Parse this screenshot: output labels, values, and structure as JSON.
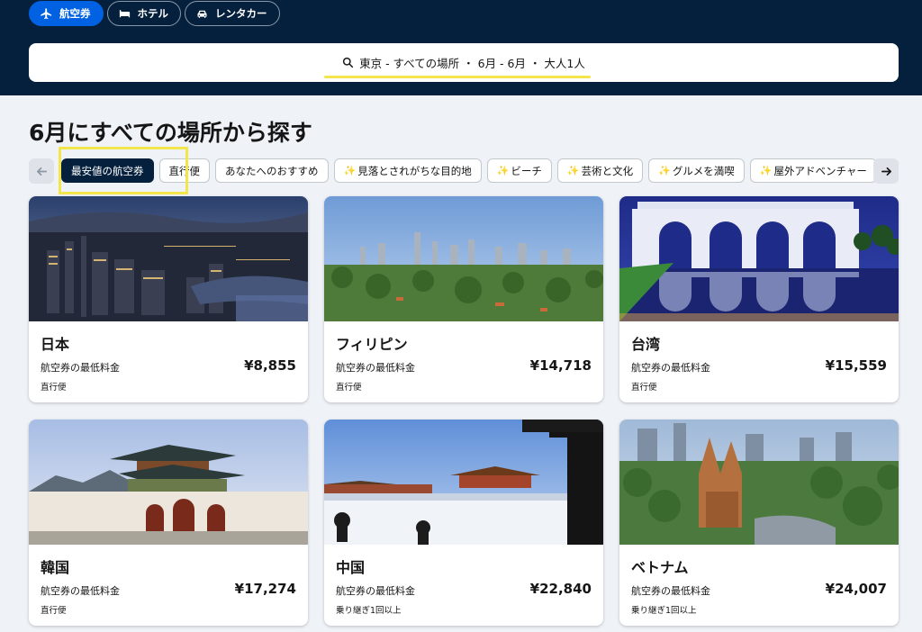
{
  "nav": {
    "items": [
      {
        "label": "航空券",
        "icon": "plane-icon",
        "active": true
      },
      {
        "label": "ホテル",
        "icon": "bed-icon",
        "active": false
      },
      {
        "label": "レンタカー",
        "icon": "car-icon",
        "active": false
      }
    ]
  },
  "search": {
    "summary": "東京 - すべての場所 ・ 6月 - 6月 ・ 大人1人"
  },
  "page": {
    "heading": "6月にすべての場所から探す"
  },
  "filters": {
    "chips": [
      {
        "label": "最安値の航空券",
        "active": true
      },
      {
        "label": "直行便"
      },
      {
        "label": "あなたへのおすすめ"
      },
      {
        "label": "見落とされがちな目的地",
        "spark": "✨"
      },
      {
        "label": "ビーチ",
        "spark": "✨"
      },
      {
        "label": "芸術と文化",
        "spark": "✨"
      },
      {
        "label": "グルメを満喫",
        "spark": "✨"
      },
      {
        "label": "屋外アドベンチャー",
        "spark": "✨"
      }
    ]
  },
  "destinations": [
    {
      "name": "日本",
      "label": "航空券の最低料金",
      "price": "¥8,855",
      "note": "直行便"
    },
    {
      "name": "フィリピン",
      "label": "航空券の最低料金",
      "price": "¥14,718",
      "note": "直行便"
    },
    {
      "name": "台湾",
      "label": "航空券の最低料金",
      "price": "¥15,559",
      "note": "直行便"
    },
    {
      "name": "韓国",
      "label": "航空券の最低料金",
      "price": "¥17,274",
      "note": "直行便"
    },
    {
      "name": "中国",
      "label": "航空券の最低料金",
      "price": "¥22,840",
      "note": "乗り継ぎ1回以上"
    },
    {
      "name": "ベトナム",
      "label": "航空券の最低料金",
      "price": "¥24,007",
      "note": "乗り継ぎ1回以上"
    }
  ],
  "colors": {
    "header_bg": "#05203c",
    "accent_blue": "#0062e3",
    "highlight_yellow": "#f3e64c",
    "page_bg": "#eff3f8"
  }
}
